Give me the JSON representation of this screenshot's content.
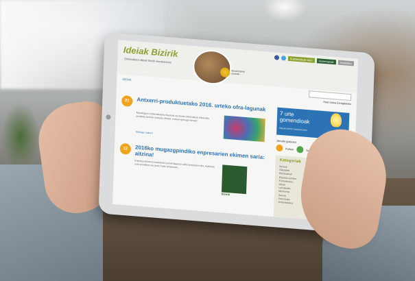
{
  "site": {
    "logo": "Ideiak Bizirik",
    "tagline": "Ekintzaileen ideiak bizirik mantentzeko",
    "badge_label": "Ideiak Bizirik sarietak",
    "nav_buttons": [
      {
        "label": "Sustatzaileak berri",
        "color": "#8ca030"
      },
      {
        "label": "Harremanak",
        "color": "#2c5d33"
      },
      {
        "label": "Harpidetu",
        "color": "#999999"
      }
    ],
    "menu": "IDEIAK",
    "user_row": "Hasi saioa  Erregistratu"
  },
  "posts": [
    {
      "date": "21",
      "title": "Antxerri-produktuetako 2016. urteko ofra-lagunak",
      "body": "Mondragon Unibertsitateko ikasleak eta beste ekintzaileak elkarrekin produktu berriak aurkeztu dituzte. Irakurri gehiago hemen.",
      "more": "Gehiago irakurri"
    },
    {
      "date": "12",
      "title": "2016ko mugazgpindiko enpresarien ekimen saria: aitzina!",
      "body": "Enpresa ekimena sustatzeko sariak bigarren aldiz antolatzen dira. Aurkeztu zure proiektua eta parte hartu lehiaketan.",
      "logo_label": "Bizirik"
    }
  ],
  "sidebar": {
    "promo_title": "7 urte gomendioak",
    "promo_sub": "Ideiak bizirik mantentzeko",
    "social_label": "Jarraitu gaitzazu",
    "social": [
      {
        "label": "Follow",
        "color": "#f2a31c"
      },
      {
        "label": "Twitter",
        "color": "#4ea646"
      }
    ],
    "categories_title": "Kategoriak",
    "categories": [
      "Berriak",
      "Ekitaldiak",
      "Ekintzaileak",
      "Enpresa sortzea",
      "Formakuntza",
      "Ideiak",
      "Lehiaketak",
      "Mentoring",
      "Sareak",
      "Teknologia",
      "Unibertsitatea"
    ]
  }
}
